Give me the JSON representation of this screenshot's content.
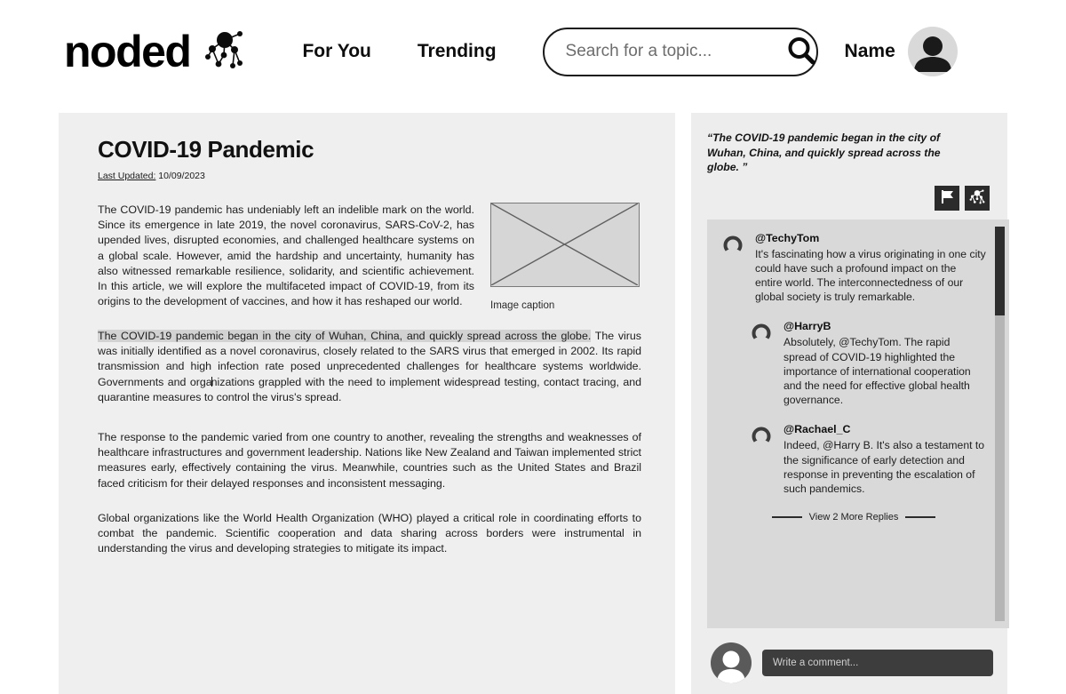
{
  "header": {
    "brand_word": "noded",
    "brand_mark_icon": "node-graph-icon",
    "nav": [
      {
        "label": "For You",
        "name": "nav-for-you"
      },
      {
        "label": "Trending",
        "name": "nav-trending"
      }
    ],
    "search": {
      "placeholder": "Search for a topic...",
      "value": "",
      "icon": "search-icon"
    },
    "user": {
      "name": "Name",
      "avatar_icon": "user-avatar-icon"
    }
  },
  "article": {
    "title": "COVID-19 Pandemic",
    "meta_label": "Last Updated:",
    "meta_value": " 10/09/2023",
    "paragraph_1": "The COVID-19 pandemic has undeniably left an indelible mark on the world. Since its emergence in late 2019, the novel coronavirus, SARS-CoV-2, has upended lives, disrupted economies, and challenged healthcare systems on a global scale. However, amid the hardship and uncertainty, humanity has also witnessed remarkable resilience, solidarity, and scientific achievement. In this article, we will explore the multifaceted impact of COVID-19, from its origins to the development of vaccines, and how it has reshaped our world.",
    "figure_caption": "Image caption",
    "paragraph_2_highlighted": "The COVID-19 pandemic began in the city of Wuhan, China, and quickly spread across the globe.",
    "paragraph_2_rest_a": " The virus was initially identified as a novel coronavirus, closely related to the SARS virus that emerged in 2002. Its rapid transmission and high infection rate posed unprecedented challenges for healthcare systems worldwide. Governments and orga",
    "paragraph_2_rest_b": "nizations grappled with the need to implement widespread testing, contact tracing, and quarantine measures to control the virus's spread.",
    "paragraph_3": "The response to the pandemic varied from one country to another, revealing the strengths and weaknesses of healthcare infrastructures and government leadership. Nations like New Zealand and Taiwan implemented strict measures early, effectively containing the virus. Meanwhile, countries such as the United States and Brazil faced criticism for their delayed responses and inconsistent messaging.",
    "paragraph_4": "Global organizations like the World Health Organization (WHO) played a critical role in coordinating efforts to combat the pandemic. Scientific cooperation and data sharing across borders were instrumental in understanding the virus and developing strategies to mitigate its impact."
  },
  "sidebar": {
    "quote": "“The COVID-19 pandemic began in the city of Wuhan, China, and quickly spread across the globe. ”",
    "actions": [
      {
        "name": "flag-button",
        "icon": "flag-icon"
      },
      {
        "name": "node-graph-button",
        "icon": "node-graph-icon"
      }
    ],
    "comments": [
      {
        "handle": "@TechyTom",
        "text": "It's fascinating how a virus originating in one city could have such a profound impact on the entire world. The interconnectedness of our global society is truly remarkable.",
        "is_reply": false
      },
      {
        "handle": "@HarryB",
        "text": "Absolutely, @TechyTom. The rapid spread of COVID-19 highlighted the importance of international cooperation and the need for effective global health governance.",
        "is_reply": true
      },
      {
        "handle": "@Rachael_C",
        "text": " Indeed, @Harry B. It's also a testament to the significance of early detection and response in preventing the escalation of such pandemics.",
        "is_reply": true
      }
    ],
    "more_replies_label": "View 2 More Replies",
    "compose": {
      "placeholder": "Write a comment...",
      "value": "",
      "avatar_icon": "user-avatar-icon"
    }
  },
  "colors": {
    "page_bg": "#ffffff",
    "panel_bg": "#efefef",
    "side_panel_bg": "#ededed",
    "thread_bg": "#d9d9d9",
    "highlight": "#d2d2d2",
    "ink": "#111111",
    "compose_bg": "#3d3d3d"
  }
}
